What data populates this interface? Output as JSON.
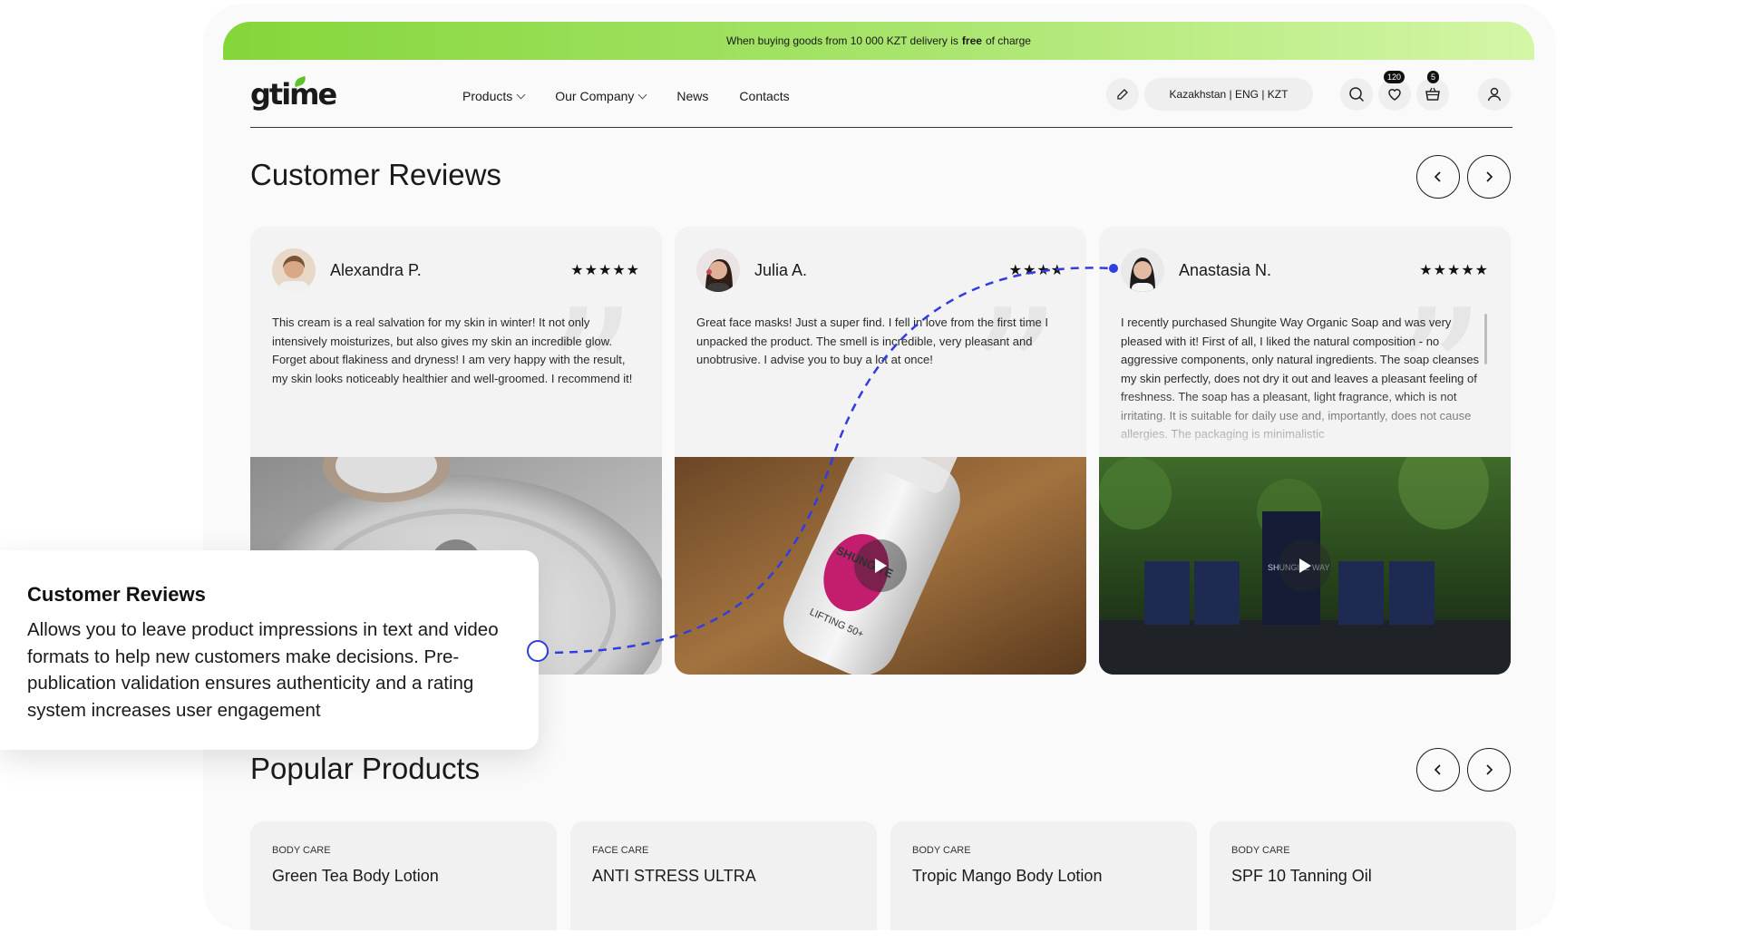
{
  "promo": {
    "text_before": "When buying goods from 10 000 KZT delivery is",
    "bold": "free",
    "text_after": "of charge"
  },
  "header": {
    "nav": [
      {
        "label": "Products",
        "has_dropdown": true
      },
      {
        "label": "Our Company",
        "has_dropdown": true
      },
      {
        "label": "News",
        "has_dropdown": false
      },
      {
        "label": "Contacts",
        "has_dropdown": false
      }
    ],
    "region": "Kazakhstan | ENG | KZT",
    "favorites_count": "120",
    "cart_count": "5",
    "icons": [
      "edit-icon",
      "search-icon",
      "heart-icon",
      "basket-icon",
      "user-icon"
    ]
  },
  "reviews": {
    "title": "Customer Reviews",
    "items": [
      {
        "name": "Alexandra P.",
        "stars": "★★★★★",
        "text": "This cream is a real salvation for my skin in winter! It not only intensively moisturizes, but also gives my skin an incredible glow. Forget about flakiness and dryness! I am very happy with the result, my skin looks noticeably healthier and well-groomed. I recommend it!"
      },
      {
        "name": "Julia A.",
        "stars": "★★★★",
        "text": "Great face masks! Just a super find. I fell in love from the first time I unpacked the product. The smell is incredible, very pleasant and unobtrusive. I advise you to buy a lot at once!"
      },
      {
        "name": "Anastasia N.",
        "stars": "★★★★★",
        "text": "I recently purchased Shungite Way Organic Soap and was very pleased with it! First of all, I liked the natural composition - no aggressive components, only natural ingredients. The soap cleanses my skin perfectly, does not dry it out and leaves a pleasant feeling of freshness. The soap has a pleasant, light fragrance, which is not irritating. It is suitable for daily use and, importantly, does not cause allergies. The packaging is minimalistic"
      }
    ]
  },
  "tooltip": {
    "title": "Customer Reviews",
    "description": "Allows you to leave product impressions in text and video formats to help new customers make decisions. Pre-publication validation ensures authenticity and a rating system increases user engagement"
  },
  "products": {
    "title": "Popular Products",
    "items": [
      {
        "category": "BODY CARE",
        "name": "Green Tea Body Lotion"
      },
      {
        "category": "FACE CARE",
        "name": "ANTI STRESS ULTRA"
      },
      {
        "category": "BODY CARE",
        "name": "Tropic Mango Body Lotion"
      },
      {
        "category": "BODY CARE",
        "name": "SPF 10 Tanning Oil"
      }
    ]
  },
  "product_packaging_text": {
    "tube_brand": "SHUNGITE",
    "tube_line": "LIFTING 50+",
    "soap_brand": "SHUNGITE WAY"
  },
  "colors": {
    "accent_green": "#84d63a",
    "connector_blue": "#2f3ee0"
  }
}
